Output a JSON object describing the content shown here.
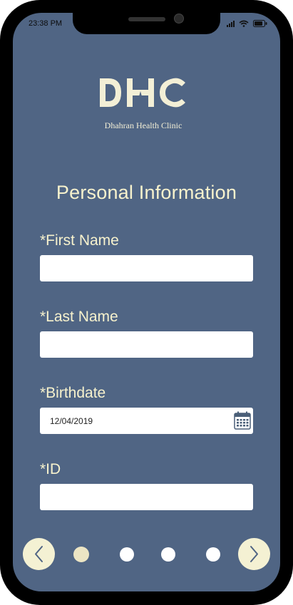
{
  "status_bar": {
    "time": "23:38 PM",
    "icons": [
      "signal-icon",
      "wifi-icon",
      "battery-icon"
    ]
  },
  "logo": {
    "letters": "DHC",
    "name": "Dhahran Health Clinic"
  },
  "title": "Personal Information",
  "form": {
    "first_name": {
      "label": "*First Name",
      "value": "",
      "placeholder": ""
    },
    "last_name": {
      "label": "*Last Name",
      "value": "",
      "placeholder": ""
    },
    "birthdate": {
      "label": "*Birthdate",
      "value": "12/04/2019",
      "icon": "calendar-icon"
    },
    "id": {
      "label": "*ID",
      "value": "",
      "placeholder": ""
    }
  },
  "pagination": {
    "total_pages": 4,
    "current_page": 1,
    "prev_icon": "chevron-left-icon",
    "next_icon": "chevron-right-icon"
  },
  "colors": {
    "background": "#506584",
    "accent": "#f4f1d3",
    "text": "#f7f2cd"
  }
}
